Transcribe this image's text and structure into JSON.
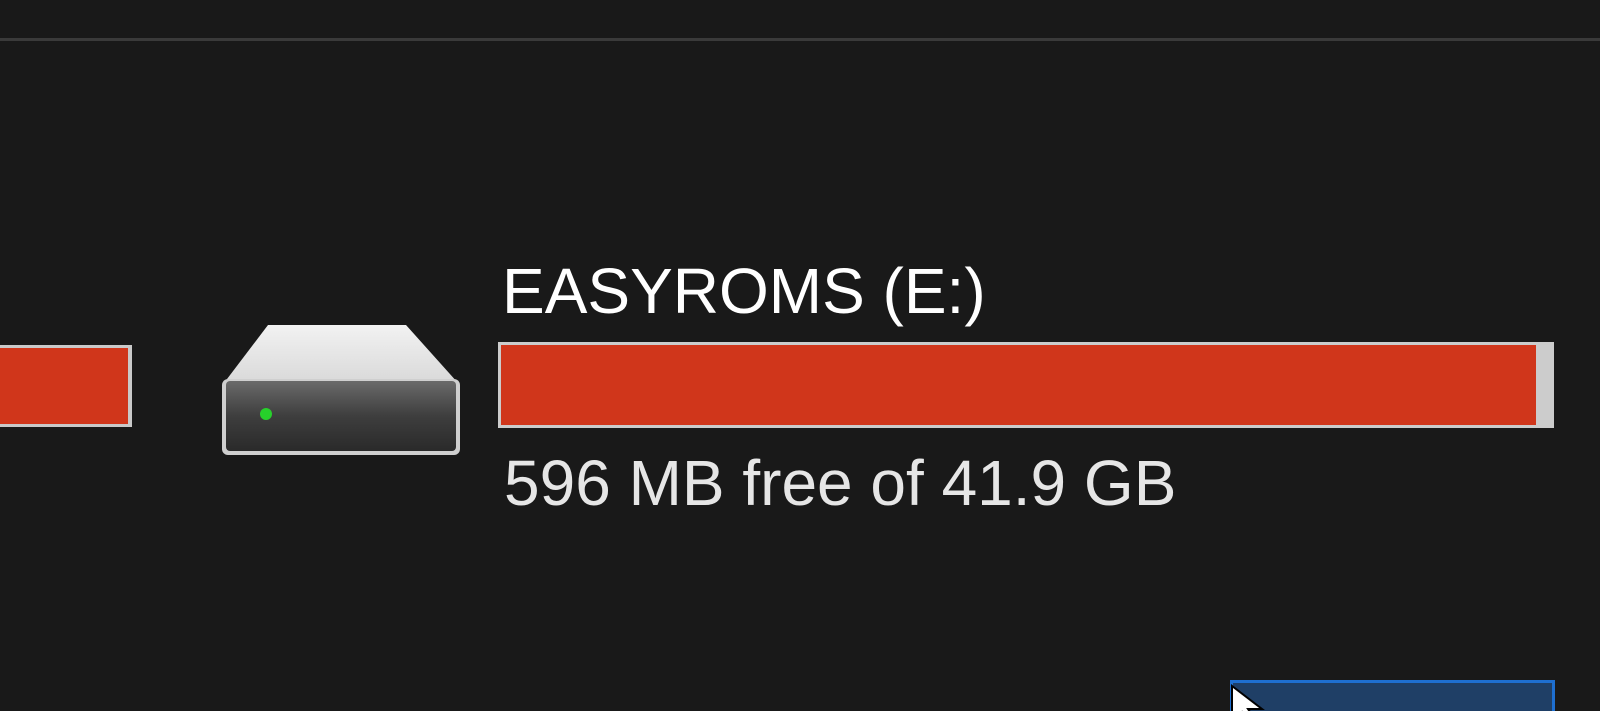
{
  "drives": [
    {
      "name": "",
      "used_fraction": 0.99,
      "colors": {
        "fill": "#d0361b",
        "track": "#c9c9c9"
      }
    },
    {
      "name": "EASYROMS (E:)",
      "free_text": "596 MB free of 41.9 GB",
      "used_fraction": 0.986,
      "icon": "hard-drive-icon",
      "colors": {
        "fill": "#d0361b",
        "track": "#cccccc",
        "led": "#27d12b"
      }
    }
  ],
  "cursor_icon": "mouse-pointer-icon",
  "colors": {
    "background": "#191919",
    "divider": "#3a3a3a",
    "selection": "#1e6fd0"
  }
}
